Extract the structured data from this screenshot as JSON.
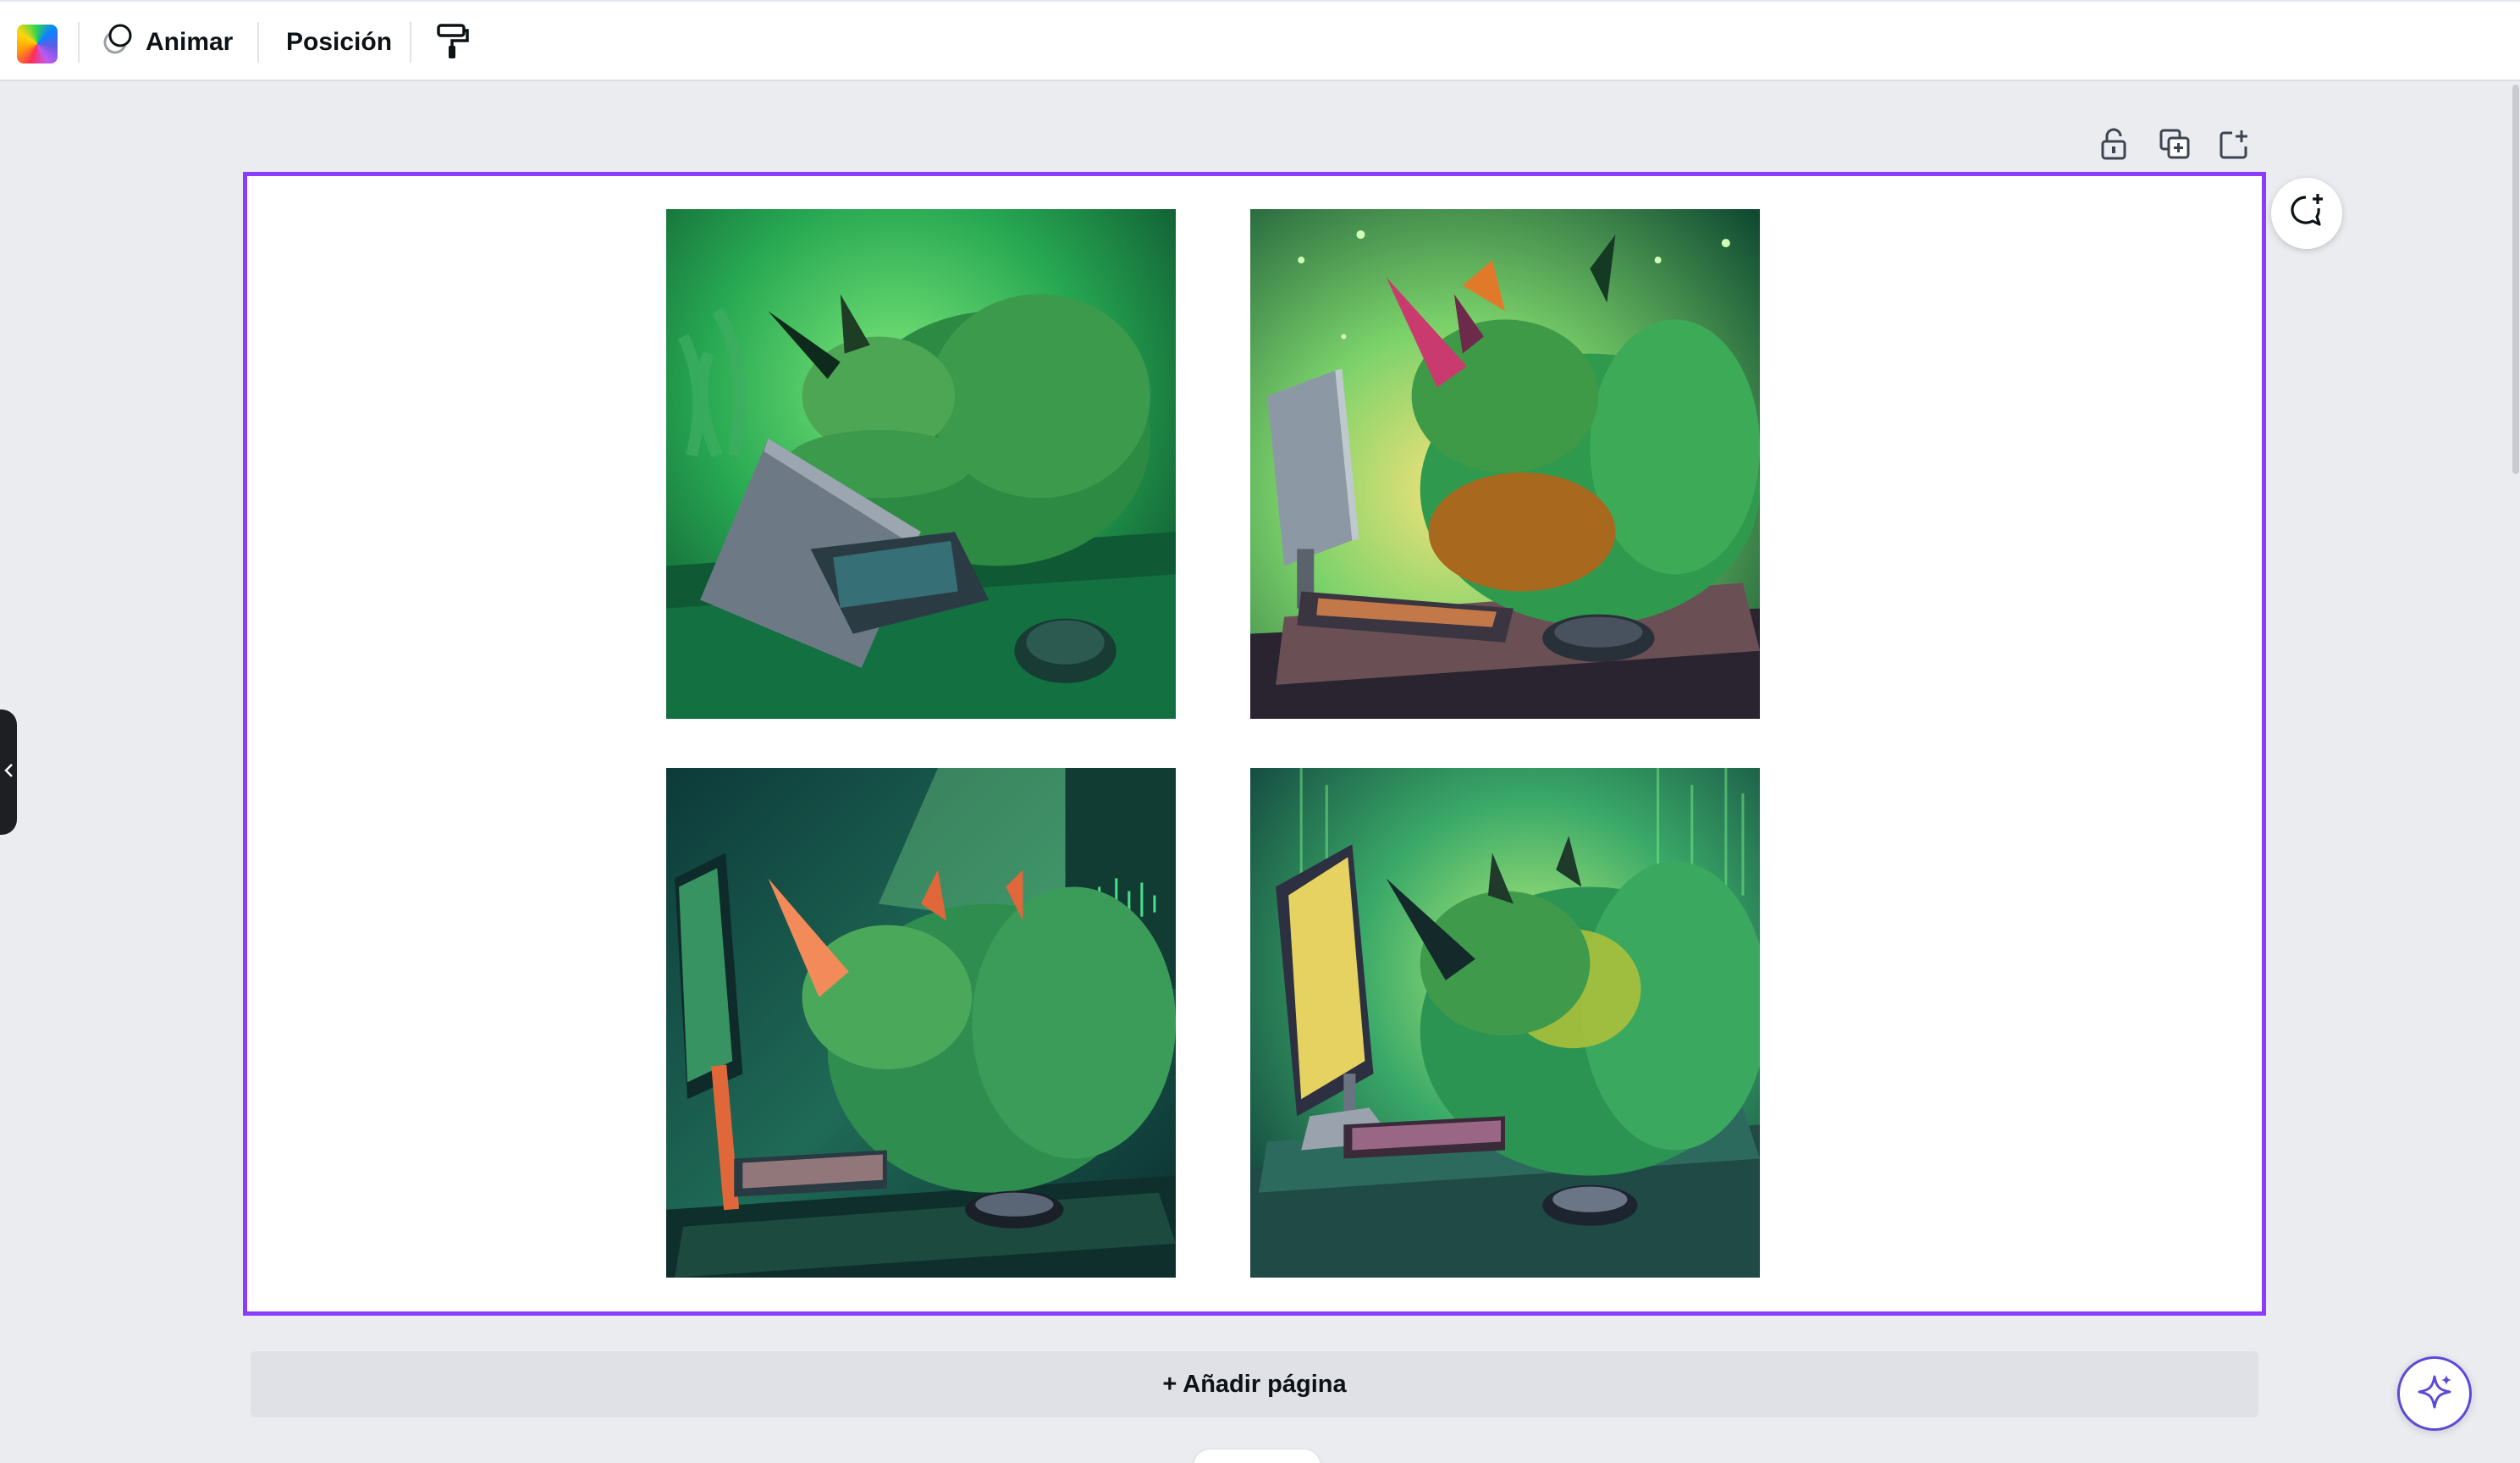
{
  "toolbar": {
    "color_icon": "color-palette-icon",
    "animate_label": "Animar",
    "animate_icon": "animate-icon",
    "position_label": "Posición",
    "paint_icon": "paint-roller-icon"
  },
  "page_controls": {
    "lock_icon": "lock-icon",
    "duplicate_icon": "duplicate-page-icon",
    "add_icon": "add-page-icon",
    "comment_icon": "add-comment-icon"
  },
  "canvas": {
    "images": [
      {
        "name": "rhino-laptop-green"
      },
      {
        "name": "rhino-monitor-orange-horn"
      },
      {
        "name": "rhino-computer-dark-room"
      },
      {
        "name": "rhino-monitor-yellow-screen"
      }
    ]
  },
  "add_page_label": "+ Añadir página",
  "assistant_icon": "magic-sparkle-icon",
  "colors": {
    "selection": "#8b3dff",
    "workspace": "#ebecf0",
    "accent": "#5b4ad8"
  }
}
